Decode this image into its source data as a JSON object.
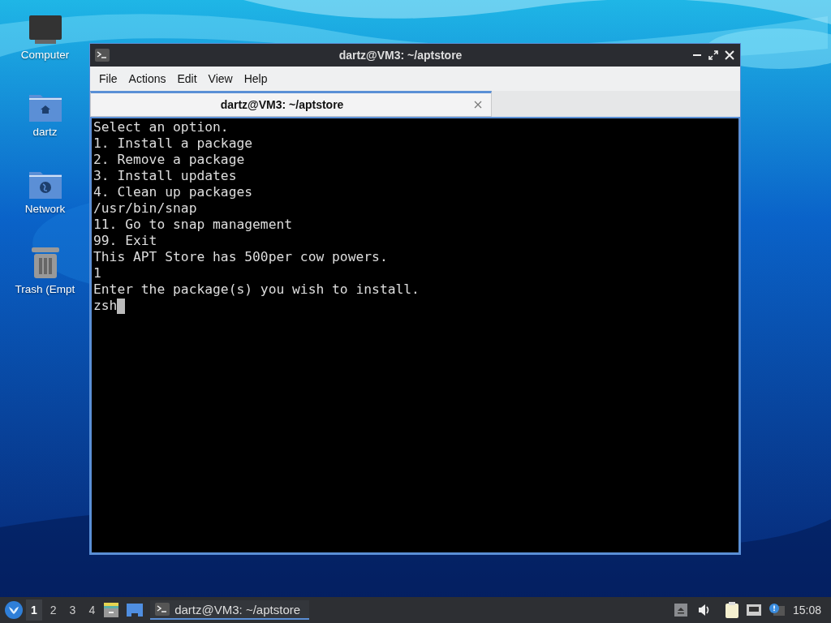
{
  "desktop_icons": [
    {
      "kind": "computer",
      "label": "Computer"
    },
    {
      "kind": "home-folder",
      "label": "dartz"
    },
    {
      "kind": "network-folder",
      "label": "Network"
    },
    {
      "kind": "trash",
      "label": "Trash (Empt"
    }
  ],
  "window": {
    "title": "dartz@VM3: ~/aptstore",
    "menu": [
      "File",
      "Actions",
      "Edit",
      "View",
      "Help"
    ],
    "tabs": [
      {
        "label": "dartz@VM3: ~/aptstore",
        "selected": true
      }
    ],
    "terminal_lines": [
      "Select an option.",
      "1. Install a package",
      "2. Remove a package",
      "3. Install updates",
      "4. Clean up packages",
      "/usr/bin/snap",
      "11. Go to snap management",
      "99. Exit",
      "This APT Store has 500per cow powers.",
      "1",
      "Enter the package(s) you wish to install."
    ],
    "input": "zsh"
  },
  "taskbar": {
    "workspaces": [
      {
        "label": "1",
        "selected": true
      },
      {
        "label": "2",
        "selected": false
      },
      {
        "label": "3",
        "selected": false
      },
      {
        "label": "4",
        "selected": false
      }
    ],
    "tasks": [
      {
        "label": "dartz@VM3: ~/aptstore",
        "selected": true
      }
    ],
    "clock": "15:08"
  }
}
